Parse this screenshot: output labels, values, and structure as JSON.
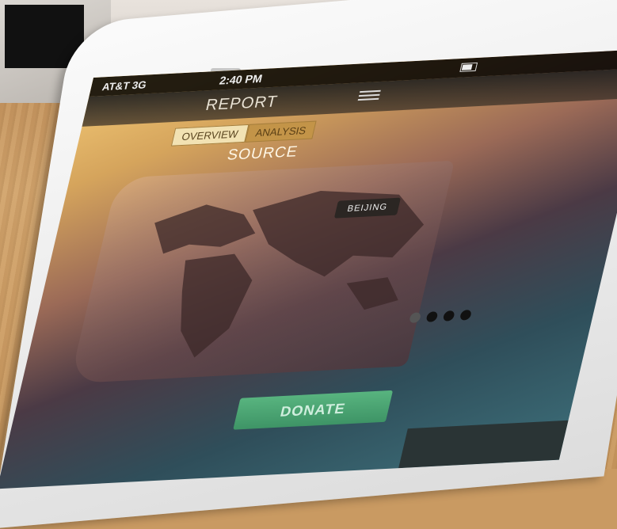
{
  "status_bar": {
    "carrier": "AT&T",
    "network": "3G",
    "time": "2:40 PM"
  },
  "nav": {
    "title": "REPORT",
    "menu_icon": "list-menu-icon"
  },
  "tabs": [
    {
      "label": "OVERVIEW",
      "active": true
    },
    {
      "label": "ANALYSIS",
      "active": false
    }
  ],
  "section_title": "SOURCE",
  "map": {
    "pin_label": "BEIJING"
  },
  "pagination": {
    "count": 4,
    "active_index": 0
  },
  "donate_label": "DONATE"
}
